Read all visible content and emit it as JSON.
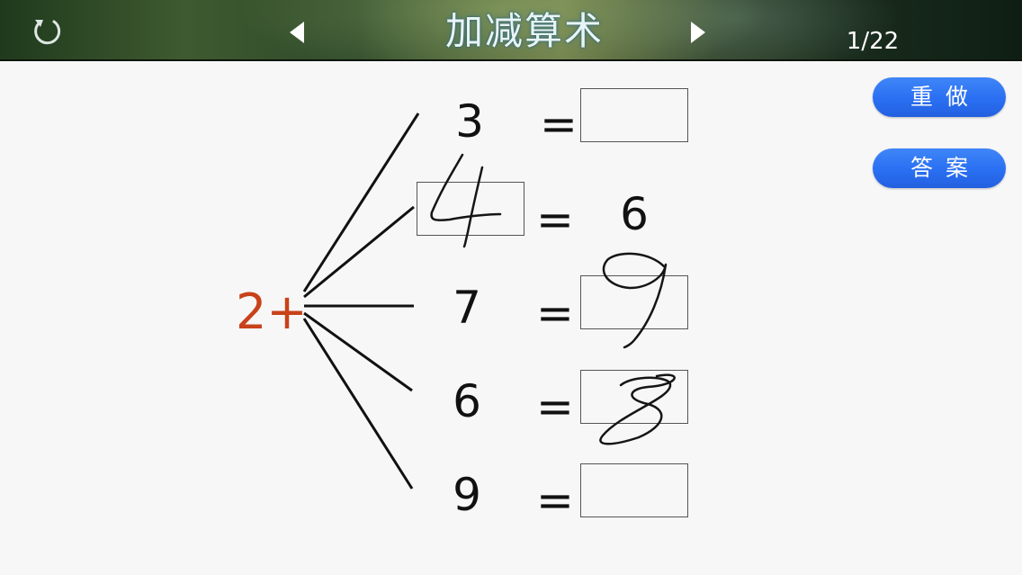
{
  "header": {
    "title": "加减算术",
    "page_counter": "1/22"
  },
  "buttons": {
    "redo_label": "重做",
    "answer_label": "答案"
  },
  "exercise": {
    "prefix": "2+",
    "rows": [
      {
        "left": "3",
        "eq": "=",
        "right": ""
      },
      {
        "left": "4",
        "eq": "=",
        "right": "6",
        "left_handwritten": true
      },
      {
        "left": "7",
        "eq": "=",
        "right": "9",
        "right_handwritten": true
      },
      {
        "left": "6",
        "eq": "=",
        "right": "8",
        "right_handwritten": true
      },
      {
        "left": "9",
        "eq": "=",
        "right": ""
      }
    ]
  },
  "colors": {
    "prefix": "#c8421a",
    "button": "#2a6ff2",
    "text": "#111111"
  },
  "icons": {
    "refresh": "refresh-icon",
    "prev": "triangle-left-icon",
    "next": "triangle-right-icon"
  }
}
